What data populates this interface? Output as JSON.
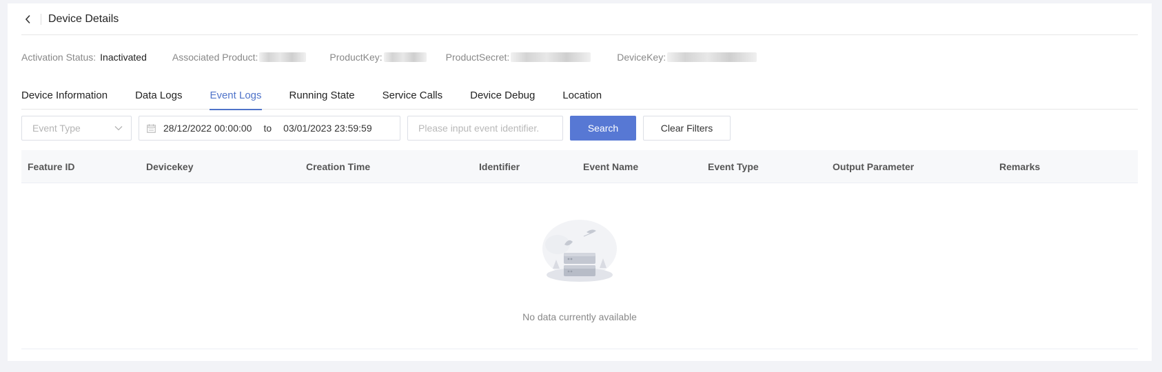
{
  "header": {
    "title": "Device Details"
  },
  "info": {
    "activation_label": "Activation Status:",
    "activation_value": "Inactivated",
    "product_label": "Associated Product:",
    "productkey_label": "ProductKey:",
    "productsecret_label": "ProductSecret:",
    "devicekey_label": "DeviceKey:"
  },
  "tabs": [
    {
      "label": "Device Information",
      "active": false
    },
    {
      "label": "Data Logs",
      "active": false
    },
    {
      "label": "Event Logs",
      "active": true
    },
    {
      "label": "Running State",
      "active": false
    },
    {
      "label": "Service Calls",
      "active": false
    },
    {
      "label": "Device Debug",
      "active": false
    },
    {
      "label": "Location",
      "active": false
    }
  ],
  "filters": {
    "event_type_placeholder": "Event Type",
    "date_start": "28/12/2022 00:00:00",
    "date_separator": "to",
    "date_end": "03/01/2023 23:59:59",
    "identifier_placeholder": "Please input event identifier.",
    "search_label": "Search",
    "clear_label": "Clear Filters"
  },
  "table": {
    "columns": [
      "Feature ID",
      "Devicekey",
      "Creation Time",
      "Identifier",
      "Event Name",
      "Event Type",
      "Output Parameter",
      "Remarks"
    ],
    "rows": [],
    "empty_text": "No data currently available"
  },
  "colors": {
    "accent": "#5778d4",
    "tab_active": "#4f73c9",
    "page_bg": "#f2f3f7"
  }
}
